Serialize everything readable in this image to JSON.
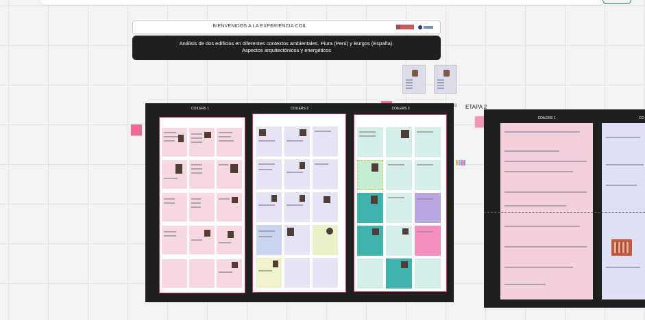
{
  "header": {
    "title": "BIENVENIDOS A LA EXPERIENCIA COIL",
    "subtitle_line1": "Análisis de dos edificios en diferentes contextos ambientales. Piura (Perú) y Burgos (España).",
    "subtitle_line2": "Aspectos arquitectónicos y energéticos"
  },
  "boards": [
    {
      "columns": [
        {
          "label": "COILERS 1"
        },
        {
          "label": "COILERS 2"
        },
        {
          "label": "COILERS 3"
        }
      ]
    },
    {
      "label": "ETAPA 2",
      "columns": [
        {
          "label": "COILERS 1"
        },
        {
          "label": "CO"
        }
      ]
    }
  ],
  "misc": {
    "small_number": "31"
  },
  "colors": {
    "board_bg": "#1f1f1f",
    "column_border": "#c73a5e",
    "pink_card": "#f6d8e1",
    "lavender_card": "#e4e4f4",
    "teal_card": "#d6eee9",
    "sticky_pink": "#f06a99"
  }
}
